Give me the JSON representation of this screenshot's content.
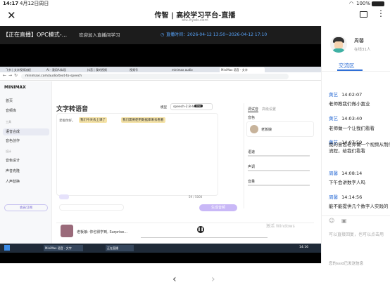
{
  "status": {
    "time": "14:17",
    "date": "4月12日周日",
    "battery": "100%"
  },
  "title": {
    "main": "传智 | 高校学习平台-直播",
    "sub": "stu.ityxb.com"
  },
  "live": {
    "tag": "【正在直播】OPC模式-...",
    "welcome": "欢迎加入直播间学习",
    "time": "直播时间：2026-04-12 13:50~2026-04-12 17:10"
  },
  "host": {
    "name": "周馨",
    "online": "在线31人"
  },
  "chat": {
    "tab": "交流区",
    "messages": [
      {
        "name": "黄艺",
        "time": "14:02:07",
        "text": "老师教我们做小富业"
      },
      {
        "name": "黄艺",
        "time": "14:03:40",
        "text": "老师做一个让我们看看"
      },
      {
        "name": "黄艺",
        "time": "14:07:59",
        "text": "我的意思老师做一个视频从制作流程，给我们看看"
      },
      {
        "name": "周馨",
        "time": "14:08:14",
        "text": "下午会讲数字人吗"
      },
      {
        "name": "周馨",
        "time": "14:14:56",
        "text": "能不能提供几个数字人实践的"
      }
    ],
    "input_placeholder": "可以直接回复，也可以点击用",
    "notice": "您的ssid已发送信息"
  },
  "browser": {
    "url": "minimaxi.com/audio/text-to-speech",
    "tabs": [
      "飞书 | 文字视频流程",
      "AI - 我用AI实现",
      "抖音 | 我的视频",
      "视频号",
      "minimax audio",
      "MiniMax 语音 - 文字"
    ],
    "app": {
      "logo": "MINIMAX",
      "nav": [
        "首页",
        "音频库",
        "语音合成",
        "音色创作",
        "音色设计",
        "声音克隆",
        "人声替换"
      ],
      "groups": [
        "工具",
        "设计"
      ],
      "page_title": "文字转语音",
      "model_label": "模型",
      "model_value": "speech-2.8-hd",
      "model_badge": "New",
      "text": "老板你好。",
      "chip1": "我们今天去上课了",
      "chip2": "我们需要使用数据库来去看看",
      "char_count": "59 / 5000",
      "settings_tabs": [
        "调试音",
        "高级设置"
      ],
      "voice_section": "音色",
      "voice_name": "老板娘",
      "sliders": [
        "语速",
        "声调",
        "音量"
      ],
      "generate": "生成音频",
      "player_title": "老板娘: 你也得学到, Surprise...",
      "footer_link": "会员订阅"
    },
    "taskbar": {
      "app1": "MiniMax 语音 - 文字",
      "app2": "正在直播",
      "clock": "14:16"
    },
    "watermark": "激活 Windows"
  }
}
